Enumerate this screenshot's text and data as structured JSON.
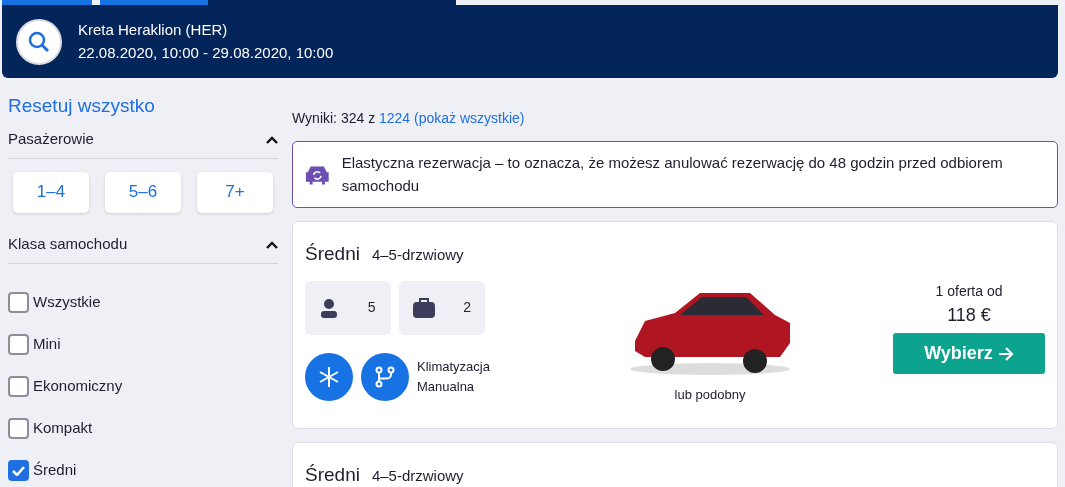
{
  "search_summary": {
    "location": "Kreta Heraklion (HER)",
    "dates": "22.08.2020, 10:00 - 29.08.2020, 10:00"
  },
  "filters": {
    "reset": "Resetuj wszystko",
    "passengers": {
      "title": "Pasażerowie",
      "expanded": true,
      "options": [
        "1–4",
        "5–6",
        "7+"
      ]
    },
    "car_class": {
      "title": "Klasa samochodu",
      "expanded": true,
      "options": [
        {
          "label": "Wszystkie",
          "checked": false
        },
        {
          "label": "Mini",
          "checked": false
        },
        {
          "label": "Ekonomiczny",
          "checked": false
        },
        {
          "label": "Kompakt",
          "checked": false
        },
        {
          "label": "Średni",
          "checked": true
        }
      ]
    }
  },
  "results": {
    "label": "Wyniki: 324 z",
    "total": "1224",
    "show_all": "(pokaż wszystkie)"
  },
  "notice": "Elastyczna rezerwacja – to oznacza, że możesz anulować rezerwację do 48 godzin przed odbiorem samochodu",
  "offers": [
    {
      "category": "Średni",
      "doors": "4–5-drzwiowy",
      "seats": "5",
      "bags": "2",
      "features": [
        "Klimatyzacja",
        "Manualna"
      ],
      "similar": "lub podobny",
      "offer_count": "1 oferta od",
      "price": "118 €",
      "button": "Wybierz"
    },
    {
      "category": "Średni",
      "doors": "4–5-drzwiowy"
    }
  ]
}
